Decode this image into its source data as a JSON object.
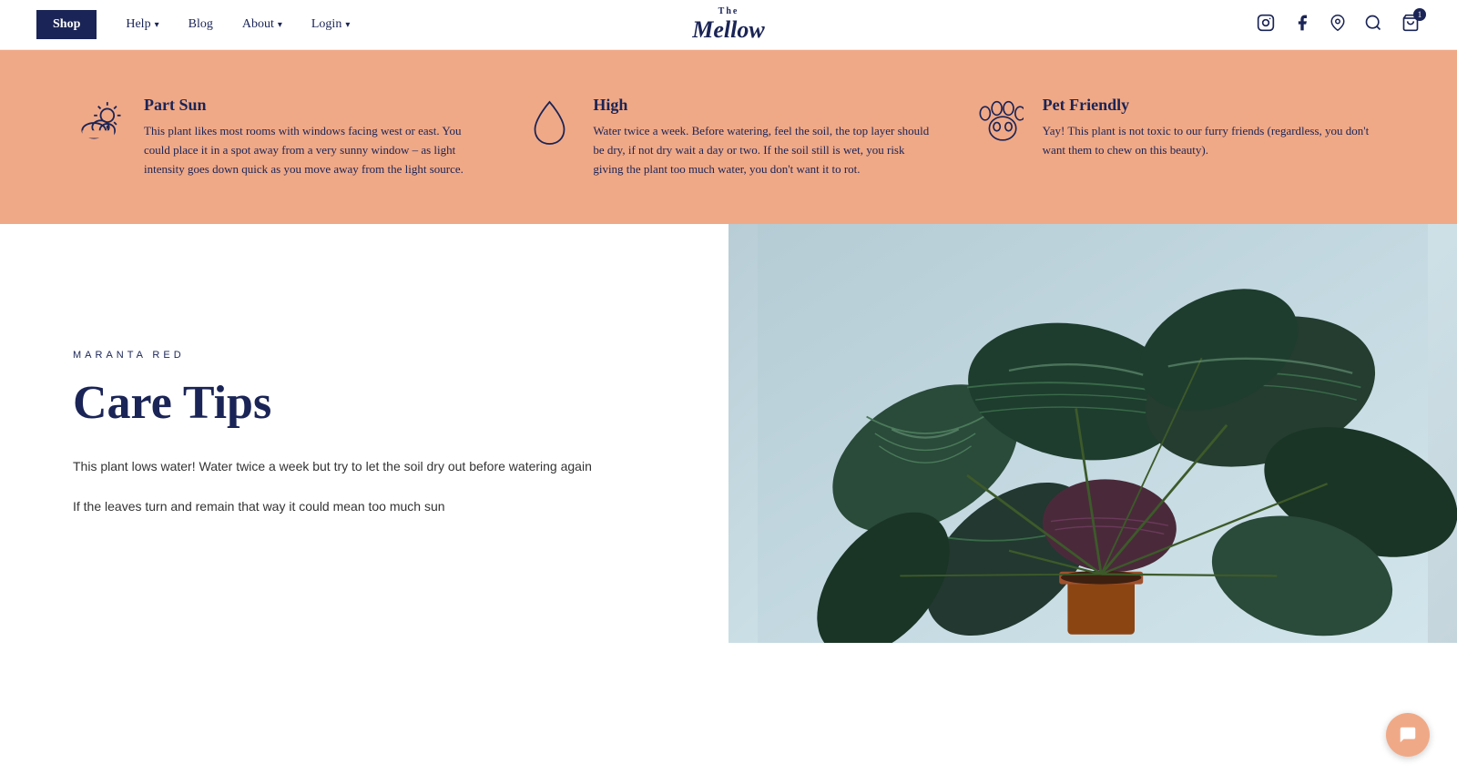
{
  "nav": {
    "shop_label": "Shop",
    "help_label": "Help",
    "blog_label": "Blog",
    "about_label": "About",
    "login_label": "Login",
    "logo_top": "The",
    "logo_main": "Mellow",
    "cart_count": "1"
  },
  "info_banner": {
    "card1": {
      "title": "Part Sun",
      "description": "This plant likes most rooms with windows facing west or east. You could place it in a spot away from a very sunny window – as light intensity goes down quick as you move away from the light source."
    },
    "card2": {
      "title": "High",
      "description": "Water twice a week. Before watering, feel the soil, the top layer should be dry, if not dry wait a day or two. If the soil still is wet, you risk giving the plant too much water, you don't want it to rot."
    },
    "card3": {
      "title": "Pet Friendly",
      "description": "Yay! This plant is not toxic to our furry friends (regardless, you don't want them to chew on this beauty)."
    }
  },
  "care_section": {
    "plant_name": "MARANTA RED",
    "title": "Care Tips",
    "desc1": "This plant lows water! Water twice a week but try to let the soil dry out before watering again",
    "desc2": "If the leaves turn and remain that way it could mean too much sun"
  }
}
